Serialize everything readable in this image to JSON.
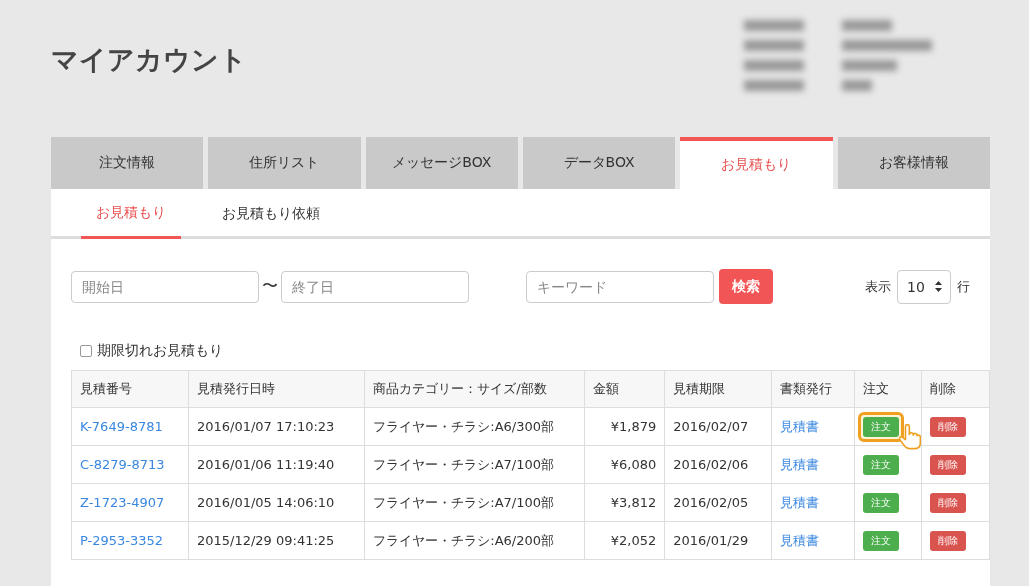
{
  "page_title": "マイアカウント",
  "tabs": [
    {
      "label": "注文情報",
      "selected": false
    },
    {
      "label": "住所リスト",
      "selected": false
    },
    {
      "label": "メッセージBOX",
      "selected": false
    },
    {
      "label": "データBOX",
      "selected": false
    },
    {
      "label": "お見積もり",
      "selected": true
    },
    {
      "label": "お客様情報",
      "selected": false
    }
  ],
  "subtabs": [
    {
      "label": "お見積もり",
      "selected": true
    },
    {
      "label": "お見積もり依頼",
      "selected": false
    }
  ],
  "filters": {
    "start_placeholder": "開始日",
    "separator": "〜",
    "end_placeholder": "終了日",
    "keyword_placeholder": "キーワード",
    "search_button": "検索",
    "display_label": "表示",
    "display_value": "10",
    "rows_label": "行"
  },
  "expired_checkbox": {
    "label": "期限切れお見積もり",
    "checked": false
  },
  "table": {
    "columns": [
      "見積番号",
      "見積発行日時",
      "商品カテゴリー：サイズ/部数",
      "金額",
      "見積期限",
      "書類発行",
      "注文",
      "削除"
    ],
    "rows": [
      {
        "number": "K-7649-8781",
        "issued": "2016/01/07 17:10:23",
        "category": "フライヤー・チラシ:A6/300部",
        "amount": "¥1,879",
        "expires": "2016/02/07",
        "document": "見積書",
        "order": "注文",
        "delete": "削除",
        "highlighted": true
      },
      {
        "number": "C-8279-8713",
        "issued": "2016/01/06 11:19:40",
        "category": "フライヤー・チラシ:A7/100部",
        "amount": "¥6,080",
        "expires": "2016/02/06",
        "document": "見積書",
        "order": "注文",
        "delete": "削除",
        "highlighted": false
      },
      {
        "number": "Z-1723-4907",
        "issued": "2016/01/05 14:06:10",
        "category": "フライヤー・チラシ:A7/100部",
        "amount": "¥3,812",
        "expires": "2016/02/05",
        "document": "見積書",
        "order": "注文",
        "delete": "削除",
        "highlighted": false
      },
      {
        "number": "P-2953-3352",
        "issued": "2015/12/29 09:41:25",
        "category": "フライヤー・チラシ:A6/200部",
        "amount": "¥2,052",
        "expires": "2016/01/29",
        "document": "見積書",
        "order": "注文",
        "delete": "削除",
        "highlighted": false
      }
    ]
  }
}
